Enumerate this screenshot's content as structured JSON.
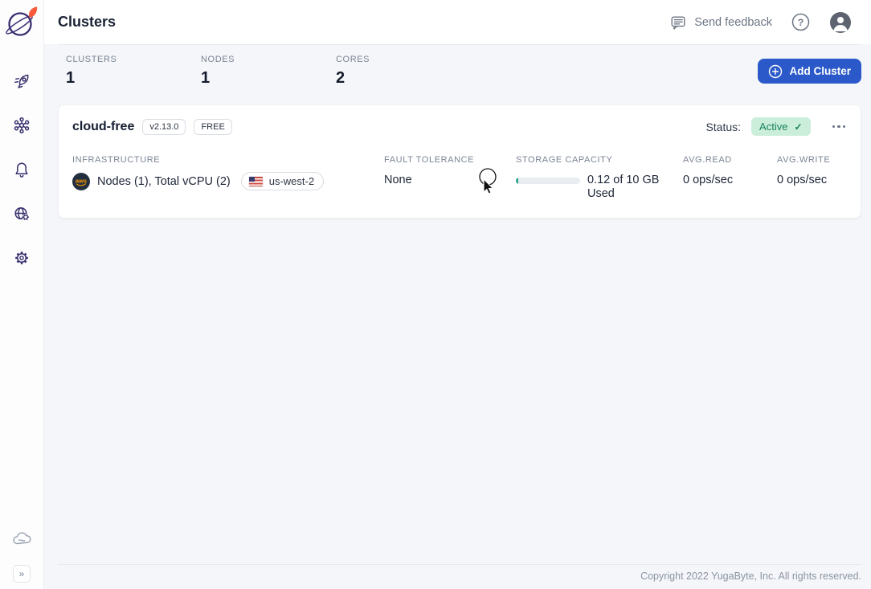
{
  "colors": {
    "accent_blue": "#2b59c9",
    "brand_navy": "#36306e",
    "status_green_bg": "#cbeeda",
    "status_green_text": "#15815c",
    "progress_fill": "#2fa890",
    "background": "#f4f6f9"
  },
  "header": {
    "title": "Clusters",
    "send_feedback_label": "Send feedback"
  },
  "sidebar": {
    "icons": [
      "rocket-icon",
      "cluster-network-icon",
      "bell-icon",
      "globe-admin-icon",
      "gear-icon",
      "cloud-icon",
      "expand-sidebar-icon"
    ],
    "expand_glyph": "»"
  },
  "stats": {
    "items": [
      {
        "label": "CLUSTERS",
        "value": "1"
      },
      {
        "label": "NODES",
        "value": "1"
      },
      {
        "label": "CORES",
        "value": "2"
      }
    ],
    "add_cluster_label": "Add Cluster"
  },
  "cluster_card": {
    "name": "cloud-free",
    "version_badge": "v2.13.0",
    "plan_badge": "FREE",
    "status_label": "Status:",
    "status_value": "Active",
    "status_check": "✓",
    "infrastructure": {
      "label": "INFRASTRUCTURE",
      "provider": "aws",
      "summary": "Nodes (1), Total vCPU (2)",
      "region": "us-west-2"
    },
    "fault_tolerance": {
      "label": "FAULT TOLERANCE",
      "value": "None"
    },
    "storage": {
      "label": "STORAGE CAPACITY",
      "usage_text": "0.12 of 10 GB Used",
      "percent_used": 1.2
    },
    "avg_read": {
      "label": "AVG.READ",
      "value": "0 ops/sec"
    },
    "avg_write": {
      "label": "AVG.WRITE",
      "value": "0 ops/sec"
    }
  },
  "footer": {
    "copyright": "Copyright 2022 YugaByte, Inc. All rights reserved."
  }
}
